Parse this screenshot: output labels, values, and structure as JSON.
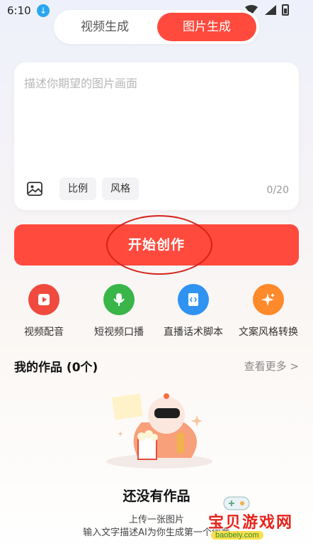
{
  "status_bar": {
    "time": "6:10"
  },
  "tabs": {
    "video_label": "视频生成",
    "image_label": "图片生成"
  },
  "prompt_card": {
    "placeholder": "描述你期望的图片画面",
    "ratio_label": "比例",
    "style_label": "风格",
    "char_count": "0/20"
  },
  "start_button": {
    "label": "开始创作"
  },
  "quick_actions": [
    {
      "label": "视频配音",
      "color": "#f04a3e",
      "icon": "video-dub-icon"
    },
    {
      "label": "短视频口播",
      "color": "#3ab54a",
      "icon": "microphone-icon"
    },
    {
      "label": "直播话术脚本",
      "color": "#2f93f2",
      "icon": "code-doc-icon"
    },
    {
      "label": "文案风格转换",
      "color": "#ff8a2b",
      "icon": "sparkle-icon"
    }
  ],
  "works": {
    "title": "我的作品 (0个)",
    "more_label": "查看更多 >"
  },
  "empty_state": {
    "title": "还没有作品",
    "line1": "上传一张图片",
    "line2": "输入文字描述AI为你生成第一个创意"
  },
  "watermark": {
    "text": "宝贝游戏网",
    "url": "baobeiy.com"
  },
  "colors": {
    "accent": "#ff4a3d"
  }
}
